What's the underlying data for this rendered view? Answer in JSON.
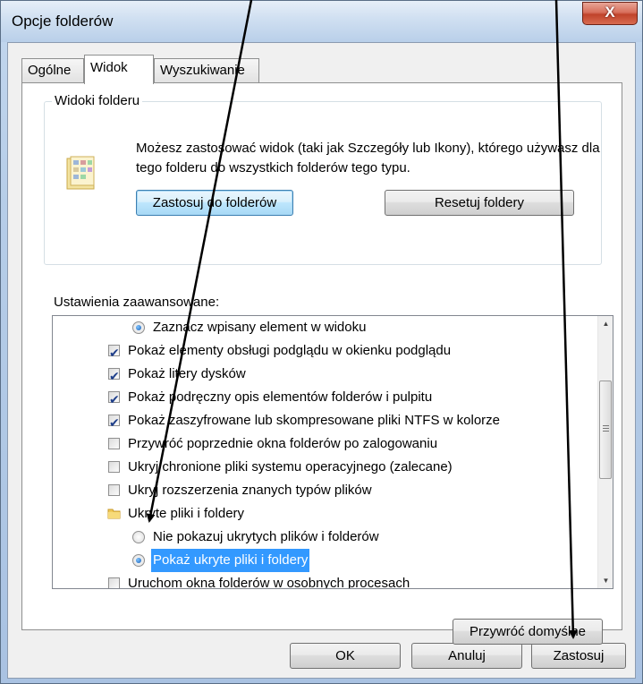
{
  "window": {
    "title": "Opcje folderów",
    "close_glyph": "X"
  },
  "tabs": [
    {
      "label": "Ogólne"
    },
    {
      "label": "Widok"
    },
    {
      "label": "Wyszukiwanie"
    }
  ],
  "folder_views": {
    "group_title": "Widoki folderu",
    "description": "Możesz zastosować widok (taki jak Szczegóły lub Ikony), którego używasz dla tego folderu do wszystkich folderów tego typu.",
    "apply_button": "Zastosuj do folderów",
    "reset_button": "Resetuj foldery"
  },
  "advanced": {
    "label": "Ustawienia zaawansowane:",
    "items": [
      {
        "type": "radio",
        "checked": true,
        "label": "Zaznacz wpisany element w widoku"
      },
      {
        "type": "checkbox",
        "checked": true,
        "label": "Pokaż elementy obsługi podglądu w okienku podglądu"
      },
      {
        "type": "checkbox",
        "checked": true,
        "label": "Pokaż litery dysków"
      },
      {
        "type": "checkbox",
        "checked": true,
        "label": "Pokaż podręczny opis elementów folderów i pulpitu"
      },
      {
        "type": "checkbox",
        "checked": true,
        "label": "Pokaż zaszyfrowane lub skompresowane pliki NTFS w kolorze"
      },
      {
        "type": "checkbox",
        "checked": false,
        "label": "Przywróć poprzednie okna folderów po zalogowaniu"
      },
      {
        "type": "checkbox",
        "checked": false,
        "label": "Ukryj chronione pliki systemu operacyjnego (zalecane)"
      },
      {
        "type": "checkbox",
        "checked": false,
        "label": "Ukryj rozszerzenia znanych typów plików"
      },
      {
        "type": "folder",
        "label": "Ukryte pliki i foldery"
      },
      {
        "type": "radio",
        "checked": false,
        "label": "Nie pokazuj ukrytych plików i folderów"
      },
      {
        "type": "radio",
        "checked": true,
        "selected": true,
        "label": "Pokaż ukryte pliki i foldery"
      },
      {
        "type": "checkbox",
        "checked": false,
        "label": "Uruchom okna folderów w osobnych procesach"
      }
    ],
    "restore_defaults": "Przywróć domyślne"
  },
  "footer": {
    "ok": "OK",
    "cancel": "Anuluj",
    "apply": "Zastosuj"
  },
  "colors": {
    "selection": "#3399ff",
    "annotation_arrows": "#000000"
  }
}
